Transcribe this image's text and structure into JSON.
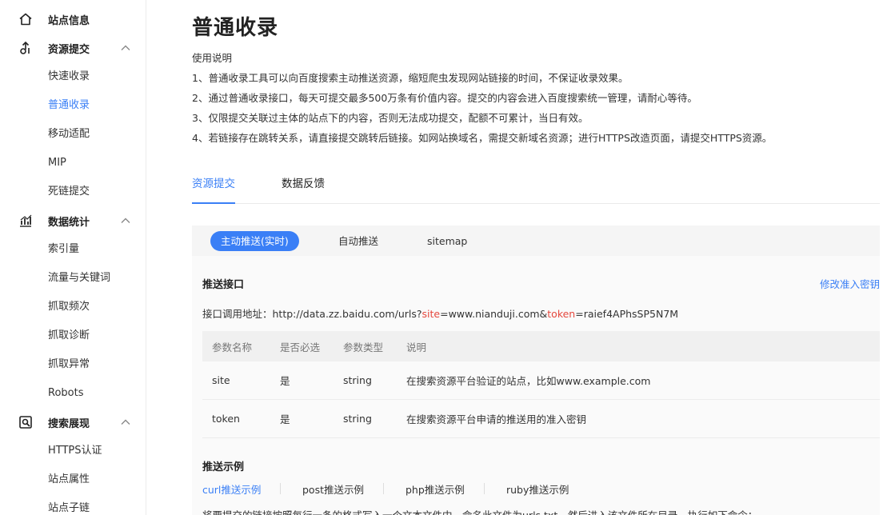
{
  "sidebar": {
    "site_info": {
      "label": "站点信息",
      "icon": "home-icon"
    },
    "resource_submit": {
      "label": "资源提交",
      "icon": "submit-icon",
      "items": [
        "快速收录",
        "普通收录",
        "移动适配",
        "MIP",
        "死链提交"
      ]
    },
    "data_stats": {
      "label": "数据统计",
      "icon": "stats-icon",
      "items": [
        "索引量",
        "流量与关键词",
        "抓取频次",
        "抓取诊断",
        "抓取异常",
        "Robots"
      ]
    },
    "search_display": {
      "label": "搜索展现",
      "icon": "search-display-icon",
      "items": [
        "HTTPS认证",
        "站点属性",
        "站点子链"
      ]
    },
    "active_item": "普通收录"
  },
  "main": {
    "title": "普通收录",
    "usage_title": "使用说明",
    "usage_lines": [
      "1、普通收录工具可以向百度搜索主动推送资源，缩短爬虫发现网站链接的时间，不保证收录效果。",
      "2、通过普通收录接口，每天可提交最多500万条有价值内容。提交的内容会进入百度搜索统一管理，请耐心等待。",
      "3、仅限提交关联过主体的站点下的内容，否则无法成功提交，配额不可累计，当日有效。",
      "4、若链接存在跳转关系，请直接提交跳转后链接。如网站换域名，需提交新域名资源；进行HTTPS改造页面，请提交HTTPS资源。"
    ],
    "tabs": [
      "资源提交",
      "数据反馈"
    ],
    "subtabs": [
      "主动推送(实时)",
      "自动推送",
      "sitemap"
    ],
    "push_api": {
      "title": "推送接口",
      "edit_link": "修改准入密钥",
      "url_prefix": "接口调用地址：http://data.zz.baidu.com/urls?",
      "param_site": "site",
      "site_value": "=www.nianduji.com&",
      "param_token": "token",
      "token_value": "=raief4APhsSP5N7M"
    },
    "table": {
      "headers": [
        "参数名称",
        "是否必选",
        "参数类型",
        "说明"
      ],
      "rows": [
        [
          "site",
          "是",
          "string",
          "在搜索资源平台验证的站点，比如www.example.com"
        ],
        [
          "token",
          "是",
          "string",
          "在搜索资源平台申请的推送用的准入密钥"
        ]
      ]
    },
    "examples": {
      "title": "推送示例",
      "tabs": [
        "curl推送示例",
        "post推送示例",
        "php推送示例",
        "ruby推送示例"
      ]
    },
    "note": "将要提交的链接按照每行一条的格式写入一个文本文件中，命名此文件为urls.txt，然后进入该文件所在目录，执行如下命令："
  },
  "colors": {
    "accent": "#3a7ff6",
    "param_highlight": "#e5483e"
  }
}
